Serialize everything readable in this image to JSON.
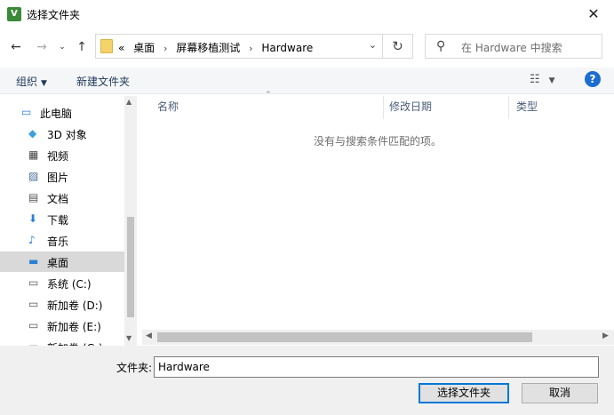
{
  "window": {
    "title": "选择文件夹",
    "app_icon_text": "V"
  },
  "nav": {
    "back_icon": "arrow-left-icon",
    "forward_icon": "arrow-right-icon",
    "up_icon": "arrow-up-icon",
    "address": {
      "overflow": "«",
      "crumbs": [
        "桌面",
        "屏幕移植测试",
        "Hardware"
      ],
      "separator": "›",
      "dropdown": "⌄"
    },
    "refresh_glyph": "↻",
    "search_placeholder": "在 Hardware 中搜索"
  },
  "command_bar": {
    "organize": "组织",
    "new_folder": "新建文件夹"
  },
  "sidebar": {
    "items": [
      {
        "label": "此电脑",
        "icon": "computer-icon",
        "indent": 0,
        "selected": false
      },
      {
        "label": "3D 对象",
        "icon": "cube-icon",
        "indent": 1,
        "selected": false
      },
      {
        "label": "视频",
        "icon": "video-icon",
        "indent": 1,
        "selected": false
      },
      {
        "label": "图片",
        "icon": "picture-icon",
        "indent": 1,
        "selected": false
      },
      {
        "label": "文档",
        "icon": "document-icon",
        "indent": 1,
        "selected": false
      },
      {
        "label": "下载",
        "icon": "download-icon",
        "indent": 1,
        "selected": false
      },
      {
        "label": "音乐",
        "icon": "music-icon",
        "indent": 1,
        "selected": false
      },
      {
        "label": "桌面",
        "icon": "desktop-icon",
        "indent": 1,
        "selected": true
      },
      {
        "label": "系统 (C:)",
        "icon": "drive-icon",
        "indent": 1,
        "selected": false
      },
      {
        "label": "新加卷 (D:)",
        "icon": "drive-icon",
        "indent": 1,
        "selected": false
      },
      {
        "label": "新加卷 (E:)",
        "icon": "drive-icon",
        "indent": 1,
        "selected": false
      },
      {
        "label": "新加卷 (G:)",
        "icon": "drive-icon",
        "indent": 1,
        "selected": false
      }
    ]
  },
  "file_list": {
    "columns": [
      "名称",
      "修改日期",
      "类型"
    ],
    "empty_message": "没有与搜索条件匹配的项。"
  },
  "footer": {
    "folder_label": "文件夹:",
    "folder_value": "Hardware",
    "select_button": "选择文件夹",
    "cancel_button": "取消"
  },
  "colors": {
    "accent": "#0078d7",
    "selected_bg": "#d9d9d9",
    "link_text": "#1e395b"
  }
}
